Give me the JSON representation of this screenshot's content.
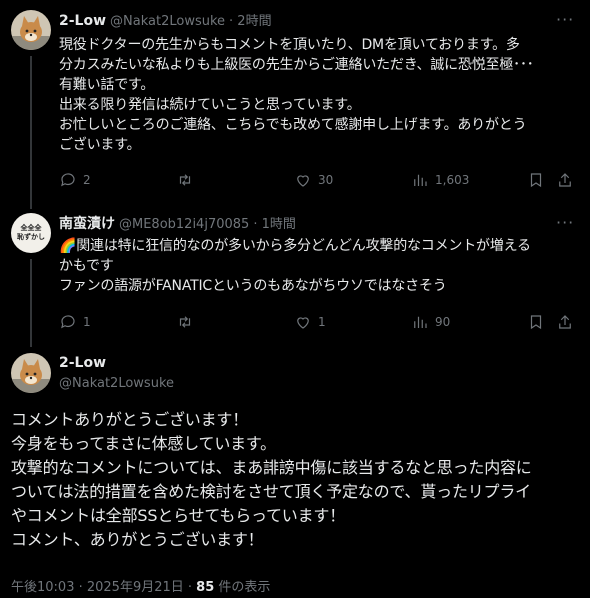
{
  "tweet1": {
    "name": "2-Low",
    "handle": "@Nakat2Lowsuke",
    "time": "· 2時間",
    "text": "現役ドクターの先生からもコメントを頂いたり、DMを頂いております。多\n分カスみたいな私よりも上級医の先生からご連絡いただき、誠に恐悦至極･･･\n有難い話です。\n出来る限り発信は続けていこうと思っています。\nお忙しいところのご連絡、こちらでも改めて感謝申し上げます。ありがとう\nございます。",
    "replies": "2",
    "retweets": "",
    "likes": "30",
    "views": "1,603"
  },
  "tweet2": {
    "name": "南蛮漬け",
    "handle": "@ME8ob12i4j70085",
    "time": "· 1時間",
    "avatar_text": "全全全\n恥ずかし",
    "text": "🌈関連は特に狂信的なのが多いから多分どんどん攻撃的なコメントが増える\nかもです\nファンの語源がFANATICというのもあながちウソではなさそう",
    "replies": "1",
    "retweets": "",
    "likes": "1",
    "views": "90"
  },
  "main_tweet": {
    "name": "2-Low",
    "handle": "@Nakat2Lowsuke",
    "text": "コメントありがとうございます！\n今身をもってまさに体感しています。\n攻撃的なコメントについては、まあ誹謗中傷に該当するなと思った内容に\nついては法的措置を含めた検討をさせて頂く予定なので、貰ったリプライ\nやコメントは全部SSとらせてもらっています！\nコメント、ありがとうございます！",
    "timestamp": "午後10:03 · 2025年9月21日 · ",
    "view_count": "85",
    "view_label": " 件の表示"
  },
  "colors": {
    "background": "#000000",
    "text": "#e7e9ea",
    "muted": "#71767b",
    "thread_line": "#333639"
  }
}
